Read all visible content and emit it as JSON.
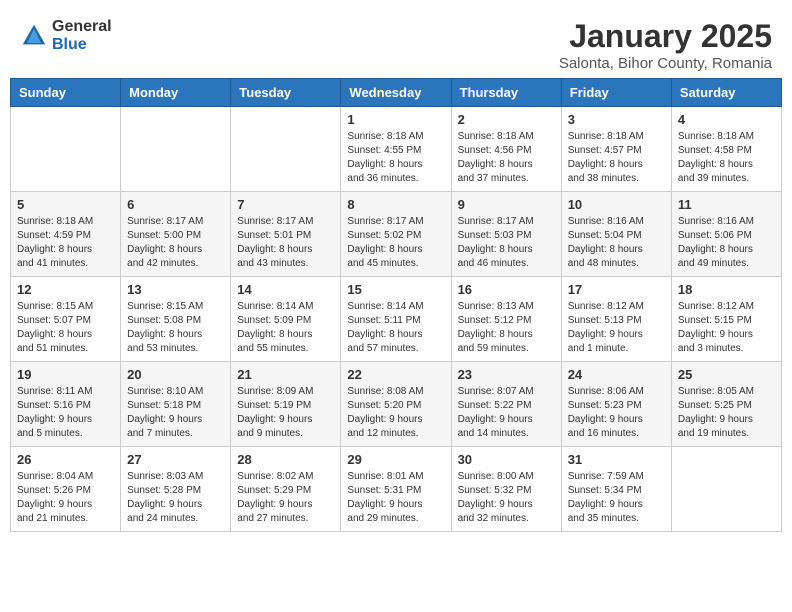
{
  "header": {
    "logo_general": "General",
    "logo_blue": "Blue",
    "month_title": "January 2025",
    "location": "Salonta, Bihor County, Romania"
  },
  "weekdays": [
    "Sunday",
    "Monday",
    "Tuesday",
    "Wednesday",
    "Thursday",
    "Friday",
    "Saturday"
  ],
  "weeks": [
    [
      {
        "day": "",
        "info": ""
      },
      {
        "day": "",
        "info": ""
      },
      {
        "day": "",
        "info": ""
      },
      {
        "day": "1",
        "info": "Sunrise: 8:18 AM\nSunset: 4:55 PM\nDaylight: 8 hours\nand 36 minutes."
      },
      {
        "day": "2",
        "info": "Sunrise: 8:18 AM\nSunset: 4:56 PM\nDaylight: 8 hours\nand 37 minutes."
      },
      {
        "day": "3",
        "info": "Sunrise: 8:18 AM\nSunset: 4:57 PM\nDaylight: 8 hours\nand 38 minutes."
      },
      {
        "day": "4",
        "info": "Sunrise: 8:18 AM\nSunset: 4:58 PM\nDaylight: 8 hours\nand 39 minutes."
      }
    ],
    [
      {
        "day": "5",
        "info": "Sunrise: 8:18 AM\nSunset: 4:59 PM\nDaylight: 8 hours\nand 41 minutes."
      },
      {
        "day": "6",
        "info": "Sunrise: 8:17 AM\nSunset: 5:00 PM\nDaylight: 8 hours\nand 42 minutes."
      },
      {
        "day": "7",
        "info": "Sunrise: 8:17 AM\nSunset: 5:01 PM\nDaylight: 8 hours\nand 43 minutes."
      },
      {
        "day": "8",
        "info": "Sunrise: 8:17 AM\nSunset: 5:02 PM\nDaylight: 8 hours\nand 45 minutes."
      },
      {
        "day": "9",
        "info": "Sunrise: 8:17 AM\nSunset: 5:03 PM\nDaylight: 8 hours\nand 46 minutes."
      },
      {
        "day": "10",
        "info": "Sunrise: 8:16 AM\nSunset: 5:04 PM\nDaylight: 8 hours\nand 48 minutes."
      },
      {
        "day": "11",
        "info": "Sunrise: 8:16 AM\nSunset: 5:06 PM\nDaylight: 8 hours\nand 49 minutes."
      }
    ],
    [
      {
        "day": "12",
        "info": "Sunrise: 8:15 AM\nSunset: 5:07 PM\nDaylight: 8 hours\nand 51 minutes."
      },
      {
        "day": "13",
        "info": "Sunrise: 8:15 AM\nSunset: 5:08 PM\nDaylight: 8 hours\nand 53 minutes."
      },
      {
        "day": "14",
        "info": "Sunrise: 8:14 AM\nSunset: 5:09 PM\nDaylight: 8 hours\nand 55 minutes."
      },
      {
        "day": "15",
        "info": "Sunrise: 8:14 AM\nSunset: 5:11 PM\nDaylight: 8 hours\nand 57 minutes."
      },
      {
        "day": "16",
        "info": "Sunrise: 8:13 AM\nSunset: 5:12 PM\nDaylight: 8 hours\nand 59 minutes."
      },
      {
        "day": "17",
        "info": "Sunrise: 8:12 AM\nSunset: 5:13 PM\nDaylight: 9 hours\nand 1 minute."
      },
      {
        "day": "18",
        "info": "Sunrise: 8:12 AM\nSunset: 5:15 PM\nDaylight: 9 hours\nand 3 minutes."
      }
    ],
    [
      {
        "day": "19",
        "info": "Sunrise: 8:11 AM\nSunset: 5:16 PM\nDaylight: 9 hours\nand 5 minutes."
      },
      {
        "day": "20",
        "info": "Sunrise: 8:10 AM\nSunset: 5:18 PM\nDaylight: 9 hours\nand 7 minutes."
      },
      {
        "day": "21",
        "info": "Sunrise: 8:09 AM\nSunset: 5:19 PM\nDaylight: 9 hours\nand 9 minutes."
      },
      {
        "day": "22",
        "info": "Sunrise: 8:08 AM\nSunset: 5:20 PM\nDaylight: 9 hours\nand 12 minutes."
      },
      {
        "day": "23",
        "info": "Sunrise: 8:07 AM\nSunset: 5:22 PM\nDaylight: 9 hours\nand 14 minutes."
      },
      {
        "day": "24",
        "info": "Sunrise: 8:06 AM\nSunset: 5:23 PM\nDaylight: 9 hours\nand 16 minutes."
      },
      {
        "day": "25",
        "info": "Sunrise: 8:05 AM\nSunset: 5:25 PM\nDaylight: 9 hours\nand 19 minutes."
      }
    ],
    [
      {
        "day": "26",
        "info": "Sunrise: 8:04 AM\nSunset: 5:26 PM\nDaylight: 9 hours\nand 21 minutes."
      },
      {
        "day": "27",
        "info": "Sunrise: 8:03 AM\nSunset: 5:28 PM\nDaylight: 9 hours\nand 24 minutes."
      },
      {
        "day": "28",
        "info": "Sunrise: 8:02 AM\nSunset: 5:29 PM\nDaylight: 9 hours\nand 27 minutes."
      },
      {
        "day": "29",
        "info": "Sunrise: 8:01 AM\nSunset: 5:31 PM\nDaylight: 9 hours\nand 29 minutes."
      },
      {
        "day": "30",
        "info": "Sunrise: 8:00 AM\nSunset: 5:32 PM\nDaylight: 9 hours\nand 32 minutes."
      },
      {
        "day": "31",
        "info": "Sunrise: 7:59 AM\nSunset: 5:34 PM\nDaylight: 9 hours\nand 35 minutes."
      },
      {
        "day": "",
        "info": ""
      }
    ]
  ]
}
